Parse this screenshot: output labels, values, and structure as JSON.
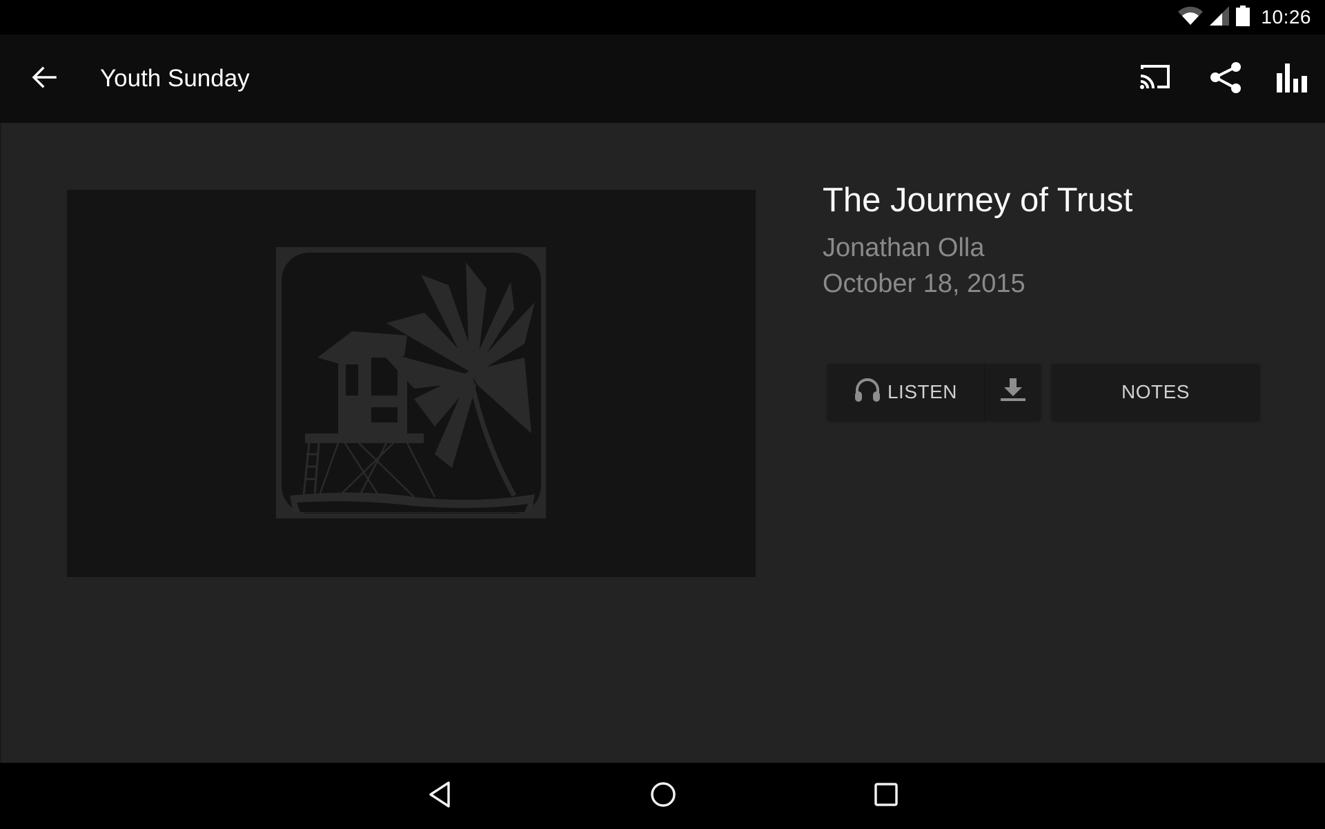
{
  "status_bar": {
    "time": "10:26",
    "icons": [
      "wifi-icon",
      "cell-signal-icon",
      "battery-icon"
    ]
  },
  "toolbar": {
    "back_icon": "arrow-left-icon",
    "title": "Youth Sunday",
    "actions": [
      {
        "name": "cast",
        "icon": "cast-icon"
      },
      {
        "name": "share",
        "icon": "share-icon"
      },
      {
        "name": "equalizer",
        "icon": "equalizer-icon"
      }
    ]
  },
  "episode": {
    "title": "The Journey of Trust",
    "speaker": "Jonathan Olla",
    "date": "October 18, 2015",
    "artwork": "lifeguard-tower-palm-logo"
  },
  "buttons": {
    "listen_label": "LISTEN",
    "listen_icon": "headphones-icon",
    "download_icon": "download-icon",
    "notes_label": "NOTES"
  },
  "navigation_bar": {
    "items": [
      "back",
      "home",
      "recents"
    ]
  },
  "colors": {
    "toolbar_bg": "#0d0d0d",
    "content_bg": "#232323",
    "artwork_bg": "#141414",
    "button_bg": "#1a1a1a",
    "primary_text": "#fafafa",
    "secondary_text": "#8a8a8a"
  }
}
